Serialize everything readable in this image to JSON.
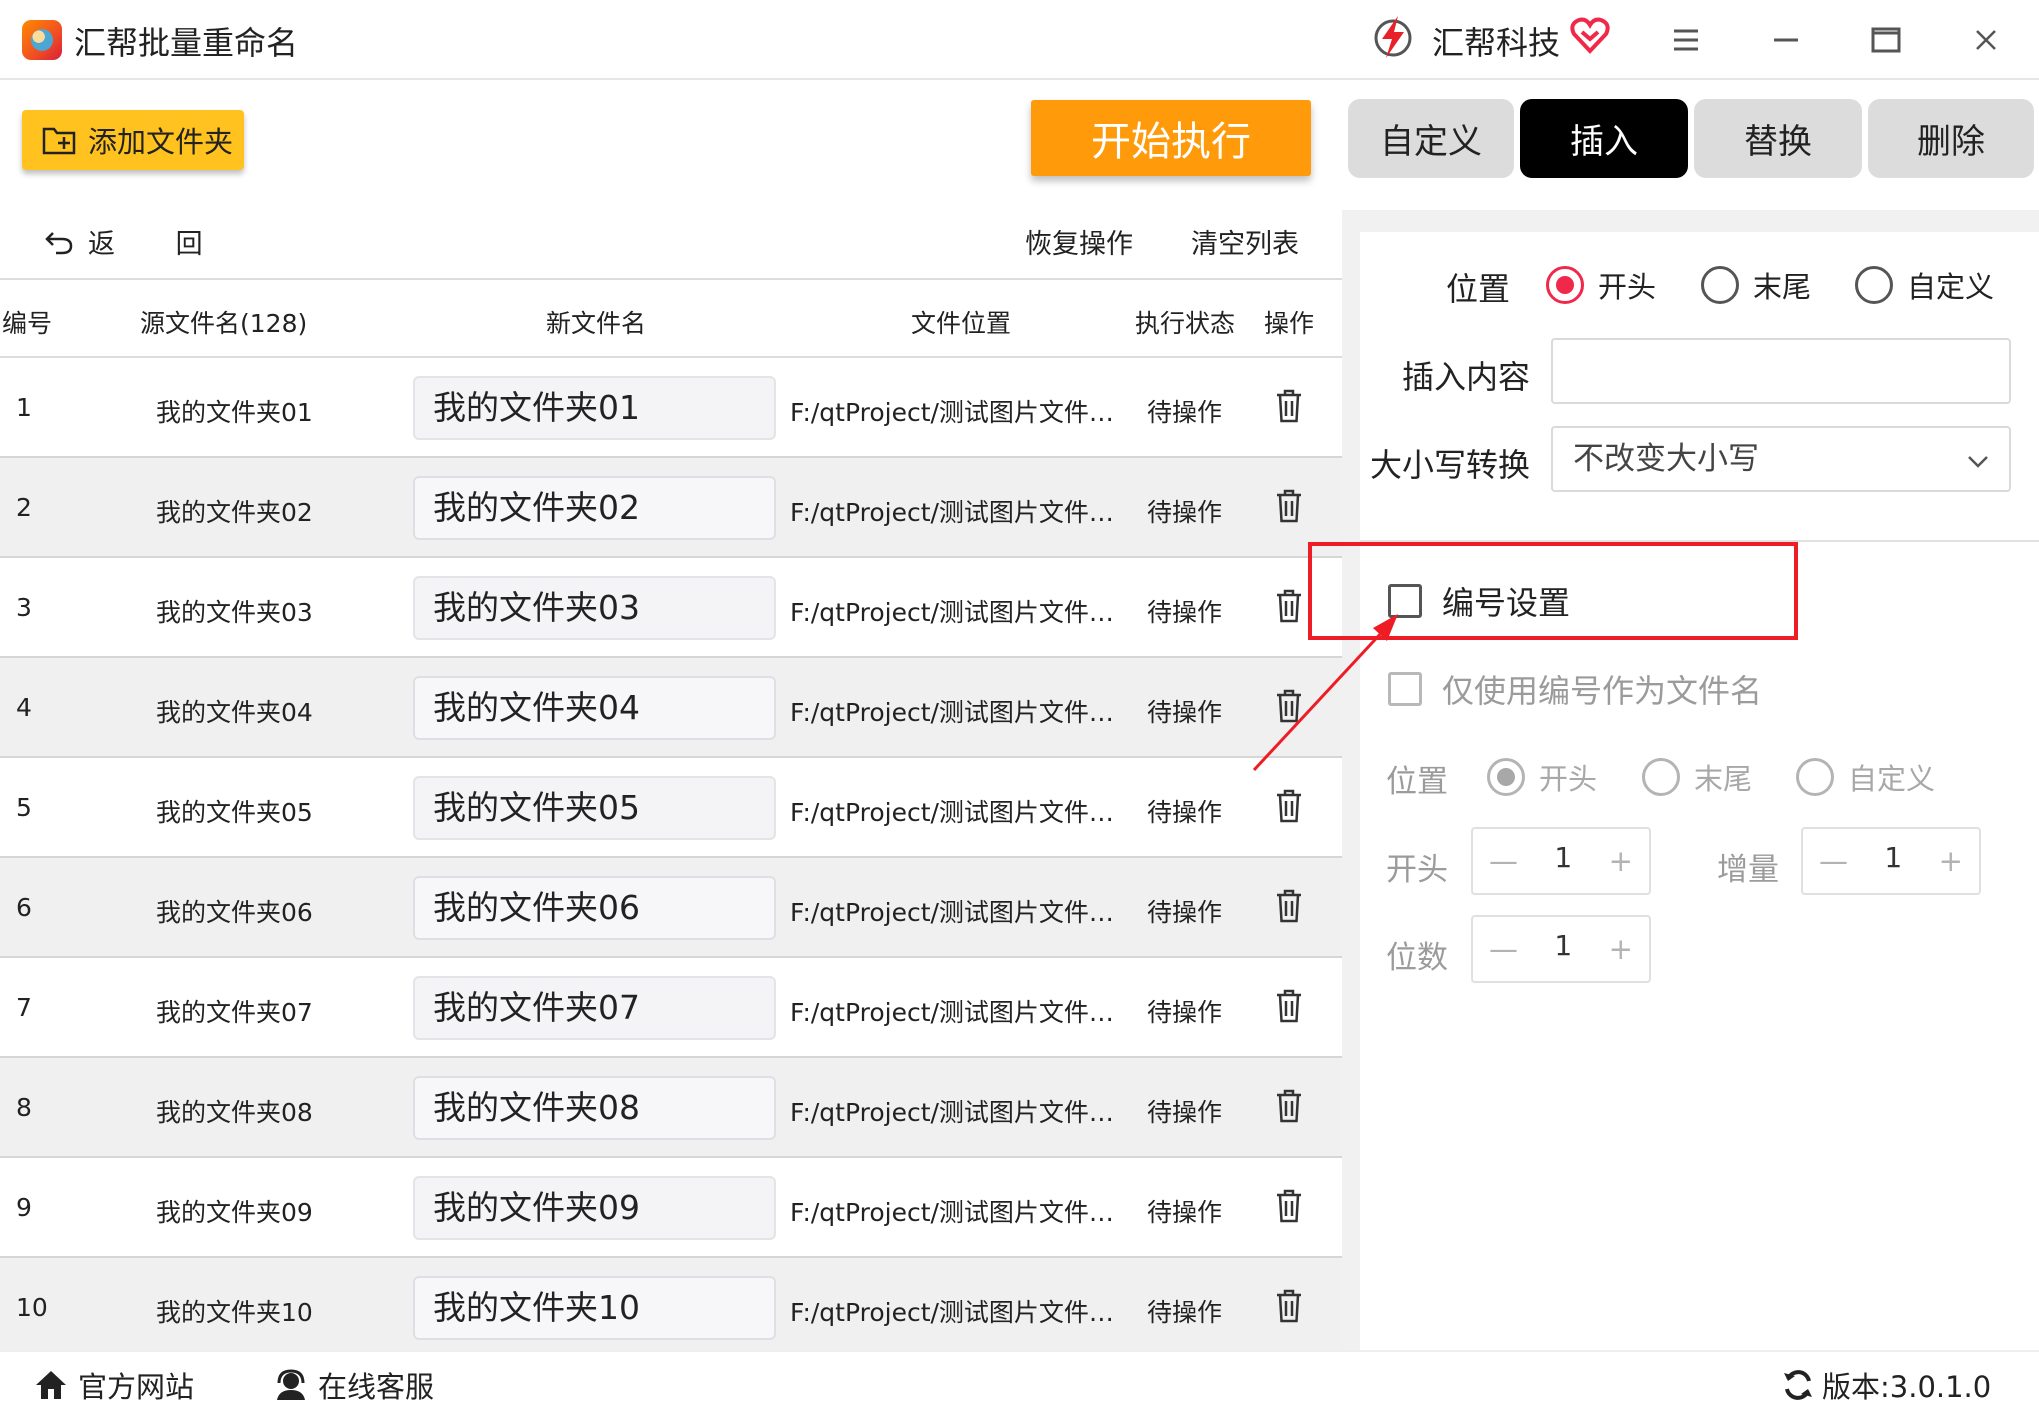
{
  "app": {
    "title": "汇帮批量重命名",
    "brand_name": "汇帮科技"
  },
  "toolbar": {
    "add_folder_label": "添加文件夹",
    "start_label": "开始执行"
  },
  "tabs": [
    {
      "label": "自定义",
      "active": false
    },
    {
      "label": "插入",
      "active": true
    },
    {
      "label": "替换",
      "active": false
    },
    {
      "label": "删除",
      "active": false
    }
  ],
  "subbar": {
    "back_label": "返 回",
    "restore_label": "恢复操作",
    "clear_label": "清空列表"
  },
  "table": {
    "headers": {
      "no": "编号",
      "source": "源文件名(128)",
      "new_name": "新文件名",
      "location": "文件位置",
      "status": "执行状态",
      "action": "操作"
    },
    "rows": [
      {
        "no": "1",
        "source": "我的文件夹01",
        "new_name": "我的文件夹01",
        "location": "F:/qtProject/测试图片文件夹/...",
        "status": "待操作"
      },
      {
        "no": "2",
        "source": "我的文件夹02",
        "new_name": "我的文件夹02",
        "location": "F:/qtProject/测试图片文件夹/...",
        "status": "待操作"
      },
      {
        "no": "3",
        "source": "我的文件夹03",
        "new_name": "我的文件夹03",
        "location": "F:/qtProject/测试图片文件夹/...",
        "status": "待操作"
      },
      {
        "no": "4",
        "source": "我的文件夹04",
        "new_name": "我的文件夹04",
        "location": "F:/qtProject/测试图片文件夹/...",
        "status": "待操作"
      },
      {
        "no": "5",
        "source": "我的文件夹05",
        "new_name": "我的文件夹05",
        "location": "F:/qtProject/测试图片文件夹/...",
        "status": "待操作"
      },
      {
        "no": "6",
        "source": "我的文件夹06",
        "new_name": "我的文件夹06",
        "location": "F:/qtProject/测试图片文件夹/...",
        "status": "待操作"
      },
      {
        "no": "7",
        "source": "我的文件夹07",
        "new_name": "我的文件夹07",
        "location": "F:/qtProject/测试图片文件夹/...",
        "status": "待操作"
      },
      {
        "no": "8",
        "source": "我的文件夹08",
        "new_name": "我的文件夹08",
        "location": "F:/qtProject/测试图片文件夹/...",
        "status": "待操作"
      },
      {
        "no": "9",
        "source": "我的文件夹09",
        "new_name": "我的文件夹09",
        "location": "F:/qtProject/测试图片文件夹/...",
        "status": "待操作"
      },
      {
        "no": "10",
        "source": "我的文件夹10",
        "new_name": "我的文件夹10",
        "location": "F:/qtProject/测试图片文件夹/...",
        "status": "待操作"
      }
    ]
  },
  "insert_panel": {
    "position_label": "位置",
    "position_options": [
      {
        "label": "开头",
        "selected": true
      },
      {
        "label": "末尾",
        "selected": false
      },
      {
        "label": "自定义",
        "selected": false
      }
    ],
    "content_label": "插入内容",
    "content_value": "",
    "case_label": "大小写转换",
    "case_value": "不改变大小写"
  },
  "numbering": {
    "enable_label": "编号设置",
    "enabled": false,
    "only_number_label": "仅使用编号作为文件名",
    "position_label": "位置",
    "position_options": [
      {
        "label": "开头",
        "selected": true
      },
      {
        "label": "末尾",
        "selected": false
      },
      {
        "label": "自定义",
        "selected": false
      }
    ],
    "start_label": "开头",
    "start_value": "1",
    "increment_label": "增量",
    "increment_value": "1",
    "digits_label": "位数",
    "digits_value": "1"
  },
  "footer": {
    "website_label": "官方网站",
    "support_label": "在线客服",
    "version_label": "版本:3.0.1.0"
  },
  "colors": {
    "accent": "#ff9a0a",
    "add_button": "#ffc21f",
    "active_tab": "#000000",
    "radio_on": "#f0284a",
    "annotation": "#ee1c24"
  }
}
